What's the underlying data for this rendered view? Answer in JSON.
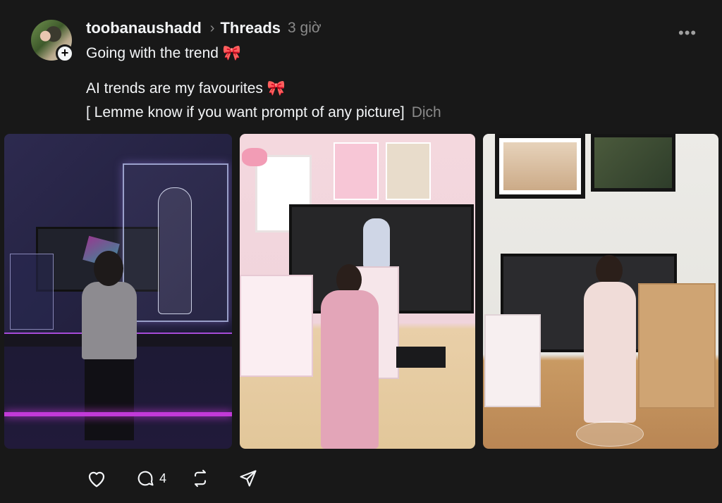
{
  "post": {
    "username": "toobanaushadd",
    "separator": "›",
    "feed_name": "Threads",
    "timestamp": "3 giờ",
    "more_label": "•••",
    "follow_label": "+",
    "line1": "Going with the trend 🎀",
    "line2": "AI trends are my favourites 🎀",
    "line3": "[ Lemme know if you want prompt of any picture]",
    "translate_label": "Dịch"
  },
  "actions": {
    "like_count": "",
    "reply_count": "4",
    "repost_count": "",
    "share_count": ""
  },
  "icons": [
    "heart-icon",
    "comment-icon",
    "repost-icon",
    "share-icon",
    "more-icon"
  ],
  "colors": {
    "background": "#181818",
    "text_primary": "#f3f5f7",
    "text_secondary": "#8a8a8a"
  }
}
